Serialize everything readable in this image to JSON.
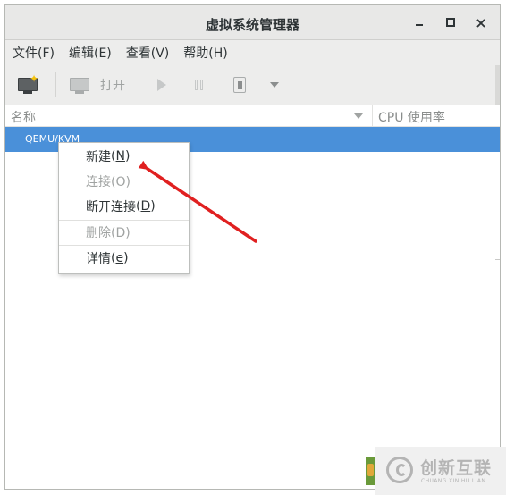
{
  "window": {
    "title": "虚拟系统管理器",
    "close_glyph": "×"
  },
  "menubar": {
    "items": [
      "文件(F)",
      "编辑(E)",
      "查看(V)",
      "帮助(H)"
    ]
  },
  "toolbar": {
    "open_label": "打开",
    "icons": [
      "new-vm-icon",
      "open-vm-icon",
      "run-icon",
      "pause-icon",
      "shutdown-icon",
      "dropdown-icon"
    ]
  },
  "columns": {
    "name": "名称",
    "cpu": "CPU 使用率"
  },
  "list": {
    "selected_row": "QEMU/KVM",
    "selection_color": "#4a90d9"
  },
  "context_menu": {
    "new": "新建",
    "new_key": "N",
    "connect": "连接(O)",
    "disconnect": "断开连接",
    "disconnect_key": "D",
    "delete": "删除(D)",
    "details": "详情",
    "details_key": "e"
  },
  "annotation": {
    "arrow_color": "#e02020"
  },
  "watermark": {
    "text": "创新互联",
    "sub": "CHUANG XIN HU LIAN"
  }
}
